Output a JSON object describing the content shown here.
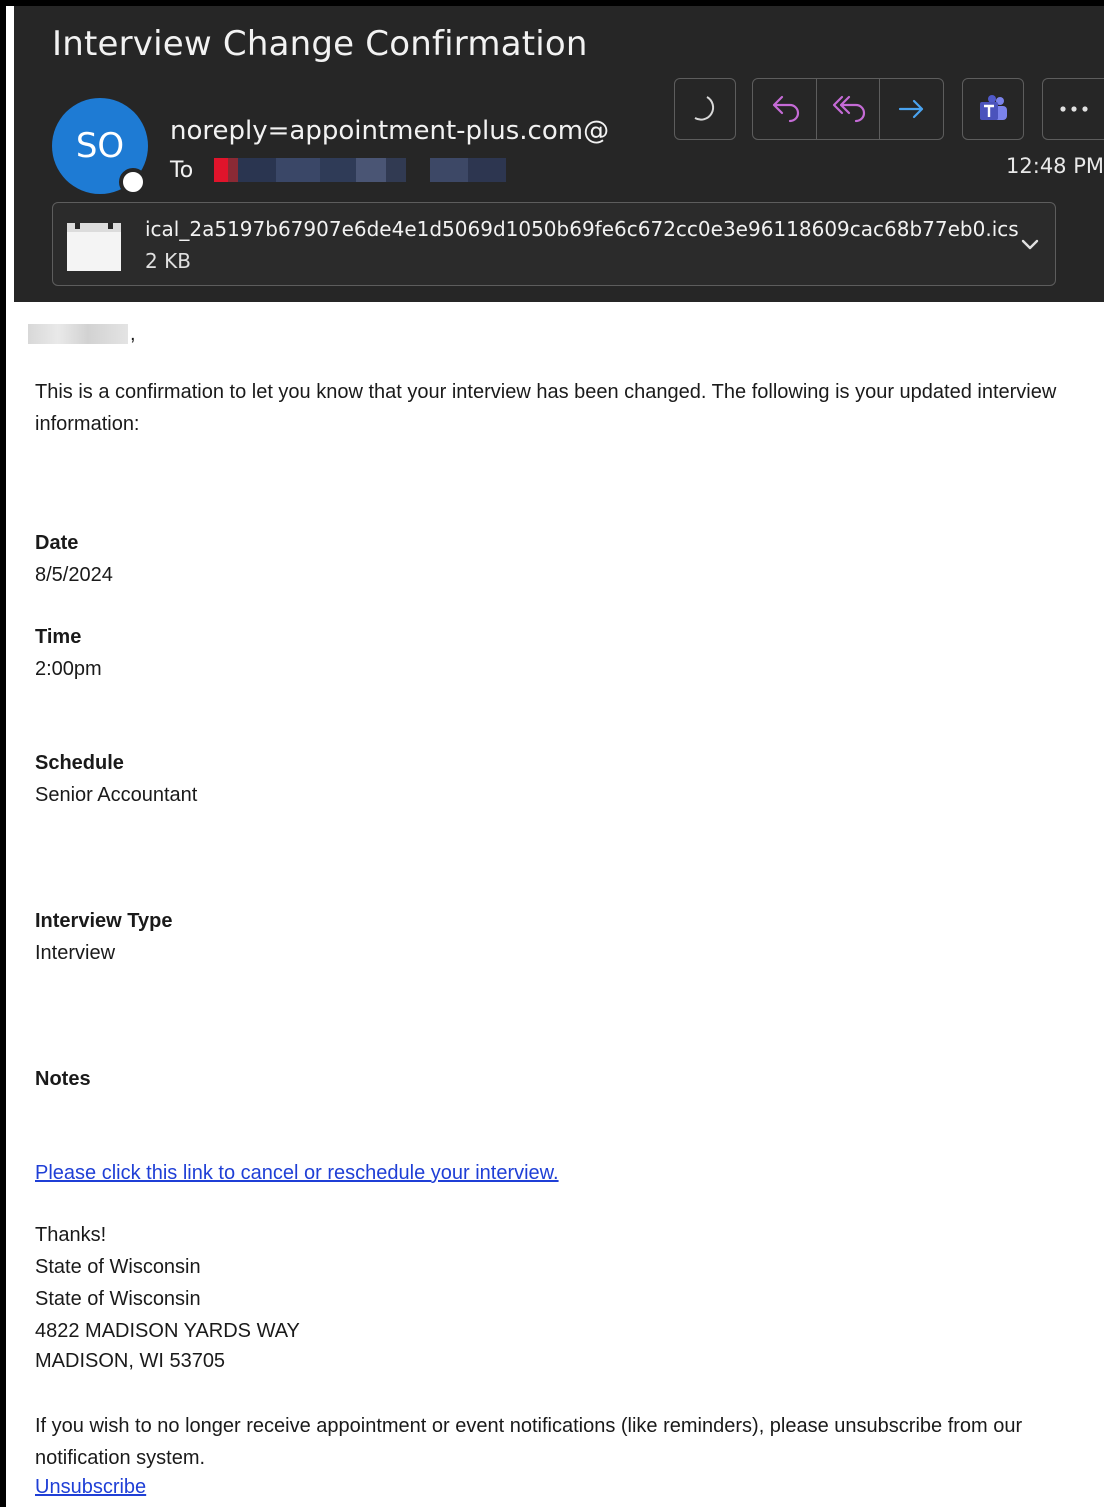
{
  "email": {
    "subject": "Interview Change Confirmation",
    "avatar_initials": "SO",
    "sender": "noreply=appointment-plus.com@",
    "to_label": "To",
    "time": "12:48 PM"
  },
  "toolbar": {
    "icons": [
      "moon-icon",
      "reply-icon",
      "reply-all-icon",
      "forward-icon",
      "teams-icon",
      "more-icon"
    ]
  },
  "attachment": {
    "filename": "ical_2a5197b67907e6de4e1d5069d1050b69fe6c672cc0e3e96118609cac68b77eb0.ics",
    "size": "2 KB"
  },
  "body": {
    "greeting_suffix": ",",
    "intro": "This is a confirmation to let you know that your interview has been changed. The following is your updated interview information:",
    "date_label": "Date",
    "date_value": "8/5/2024",
    "time_label": "Time",
    "time_value": "2:00pm",
    "schedule_label": "Schedule",
    "schedule_value": "Senior Accountant",
    "type_label": "Interview Type",
    "type_value": "Interview",
    "notes_label": "Notes",
    "reschedule_link": "Please click this link to cancel or reschedule your interview.",
    "signoff": [
      "Thanks!",
      "State of Wisconsin",
      "State of Wisconsin",
      "4822 MADISON YARDS WAY",
      "MADISON, WI 53705"
    ],
    "unsubscribe_text": "If you wish to no longer receive appointment or event notifications (like reminders), please unsubscribe from our notification system.",
    "unsubscribe_link": "Unsubscribe"
  },
  "colors": {
    "header_bg": "#262626",
    "avatar": "#1e7bd4",
    "reply_accent": "#c56bd6",
    "forward_accent": "#4aa3f0",
    "link": "#1f3fd6"
  }
}
